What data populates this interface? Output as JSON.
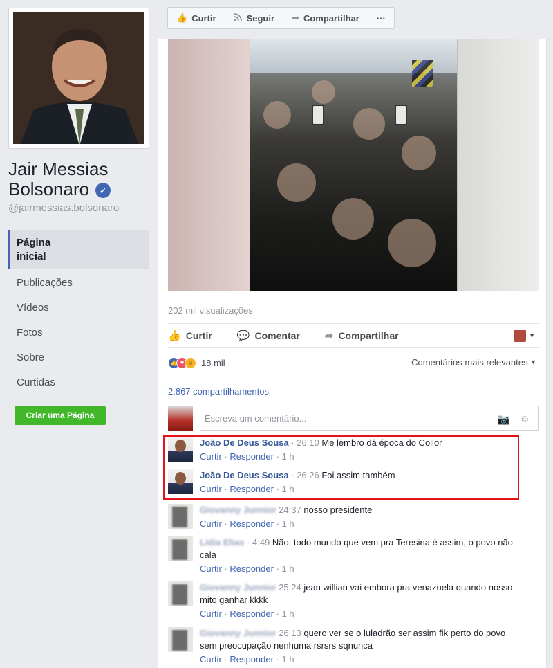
{
  "sidebar": {
    "page_name_line1": "Jair Messias",
    "page_name_line2": "Bolsonaro",
    "verified_glyph": "✓",
    "handle": "@jairmessias.bolsonaro",
    "nav": [
      {
        "label_line1": "Página",
        "label_line2": "inicial"
      },
      {
        "label": "Publicações"
      },
      {
        "label": "Vídeos"
      },
      {
        "label": "Fotos"
      },
      {
        "label": "Sobre"
      },
      {
        "label": "Curtidas"
      }
    ],
    "create_page_button": "Criar uma Página"
  },
  "topbar": {
    "like": "Curtir",
    "follow": "Seguir",
    "share": "Compartilhar",
    "more": "···"
  },
  "post": {
    "views": "202 mil visualizações",
    "actions": {
      "like": "Curtir",
      "comment": "Comentar",
      "share": "Compartilhar"
    },
    "reactions_count": "18 mil",
    "relevance": "Comentários mais relevantes",
    "shares": "2.867 compartilhamentos",
    "comment_placeholder": "Escreva um comentário...",
    "icons": {
      "camera": "📷",
      "emoji": "☺",
      "like": "👍",
      "comment": "💬",
      "share": "➦"
    }
  },
  "comments": [
    {
      "name": "João De Deus Sousa",
      "time": "26:10",
      "text": "Me lembro dá época do Collor",
      "like": "Curtir",
      "reply": "Responder",
      "age": "1 h"
    },
    {
      "name": "João De Deus Sousa",
      "time": "26:26",
      "text": "Foi assim também",
      "like": "Curtir",
      "reply": "Responder",
      "age": "1 h"
    },
    {
      "name": "Giovanny Junnior",
      "time": "24:37",
      "text": "nosso presidente",
      "like": "Curtir",
      "reply": "Responder",
      "age": "1 h"
    },
    {
      "name": "Lídia Elias",
      "time": "4:49",
      "text": "Não, todo mundo que vem pra Teresina é assim, o povo não cala",
      "like": "Curtir",
      "reply": "Responder",
      "age": "1 h"
    },
    {
      "name": "Giovanny Junnior",
      "time": "25:24",
      "text": "jean willian vai embora pra venazuela quando nosso mito ganhar kkkk",
      "like": "Curtir",
      "reply": "Responder",
      "age": "1 h"
    },
    {
      "name": "Giovanny Junnior",
      "time": "26:13",
      "text": "quero ver se o luladrão ser assim fik perto do povo sem preocupação nenhuma rsrsrs sqnunca",
      "like": "Curtir",
      "reply": "Responder",
      "age": "1 h"
    }
  ],
  "colors": {
    "accent": "#4267b2",
    "link": "#365899",
    "highlight": "#e0141a",
    "create_button": "#42b72a"
  }
}
